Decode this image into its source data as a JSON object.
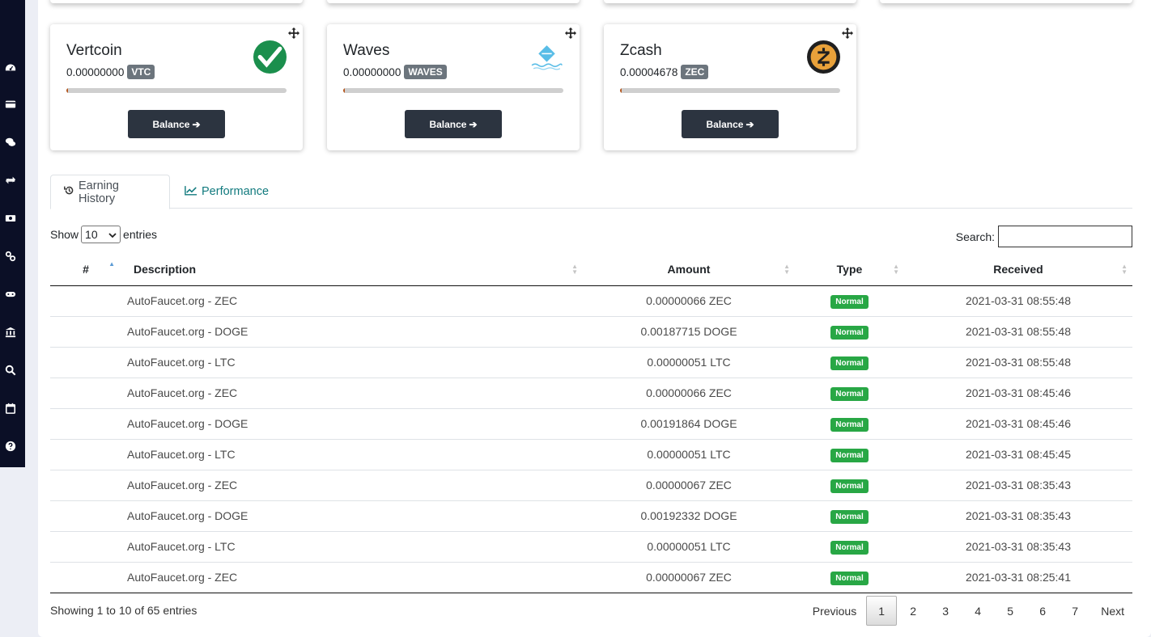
{
  "sidebar": {
    "icons": [
      "dashboard-icon",
      "credit-card-icon",
      "comments-icon",
      "exchange-icon",
      "money-icon",
      "link-icon",
      "gamepad-icon",
      "bank-icon",
      "search-icon",
      "calendar-icon",
      "question-circle-icon"
    ]
  },
  "coins": [
    {
      "name": "Vertcoin",
      "balance": "0.00000000",
      "ticker": "VTC",
      "progress": 0,
      "button": "Balance",
      "logo": "vertcoin-logo",
      "logo_color": "#1b8f4d"
    },
    {
      "name": "Waves",
      "balance": "0.00000000",
      "ticker": "WAVES",
      "progress": 0,
      "button": "Balance",
      "logo": "waves-logo",
      "logo_color": "#59bde7"
    },
    {
      "name": "Zcash",
      "balance": "0.00004678",
      "ticker": "ZEC",
      "progress": 0,
      "button": "Balance",
      "logo": "zcash-logo",
      "logo_color": "#e8a13a"
    }
  ],
  "tabs": [
    {
      "label": "Earning History",
      "icon": "history-icon",
      "active": true
    },
    {
      "label": "Performance",
      "icon": "line-chart-icon",
      "active": false
    }
  ],
  "table_controls": {
    "show_label": "Show",
    "entries_value": "10",
    "entries_label": "entries",
    "search_label": "Search:",
    "search_value": ""
  },
  "table": {
    "columns": [
      "#",
      "Description",
      "Amount",
      "Type",
      "Received"
    ],
    "rows": [
      {
        "num": "",
        "description": "AutoFaucet.org - ZEC",
        "amount": "0.00000066 ZEC",
        "type": "Normal",
        "received": "2021-03-31 08:55:48"
      },
      {
        "num": "",
        "description": "AutoFaucet.org - DOGE",
        "amount": "0.00187715 DOGE",
        "type": "Normal",
        "received": "2021-03-31 08:55:48"
      },
      {
        "num": "",
        "description": "AutoFaucet.org - LTC",
        "amount": "0.00000051 LTC",
        "type": "Normal",
        "received": "2021-03-31 08:55:48"
      },
      {
        "num": "",
        "description": "AutoFaucet.org - ZEC",
        "amount": "0.00000066 ZEC",
        "type": "Normal",
        "received": "2021-03-31 08:45:46"
      },
      {
        "num": "",
        "description": "AutoFaucet.org - DOGE",
        "amount": "0.00191864 DOGE",
        "type": "Normal",
        "received": "2021-03-31 08:45:46"
      },
      {
        "num": "",
        "description": "AutoFaucet.org - LTC",
        "amount": "0.00000051 LTC",
        "type": "Normal",
        "received": "2021-03-31 08:45:45"
      },
      {
        "num": "",
        "description": "AutoFaucet.org - ZEC",
        "amount": "0.00000067 ZEC",
        "type": "Normal",
        "received": "2021-03-31 08:35:43"
      },
      {
        "num": "",
        "description": "AutoFaucet.org - DOGE",
        "amount": "0.00192332 DOGE",
        "type": "Normal",
        "received": "2021-03-31 08:35:43"
      },
      {
        "num": "",
        "description": "AutoFaucet.org - LTC",
        "amount": "0.00000051 LTC",
        "type": "Normal",
        "received": "2021-03-31 08:35:43"
      },
      {
        "num": "",
        "description": "AutoFaucet.org - ZEC",
        "amount": "0.00000067 ZEC",
        "type": "Normal",
        "received": "2021-03-31 08:25:41"
      }
    ]
  },
  "footer": {
    "info": "Showing 1 to 10 of 65 entries",
    "previous": "Previous",
    "next": "Next",
    "pages": [
      "1",
      "2",
      "3",
      "4",
      "5",
      "6",
      "7"
    ],
    "current_page": "1"
  },
  "colors": {
    "sidebar_bg": "#0b0f26",
    "button_dark": "#2c3440",
    "badge_green": "#28a745",
    "tab_link": "#117a7e",
    "ticker_gray": "#6c757d"
  }
}
